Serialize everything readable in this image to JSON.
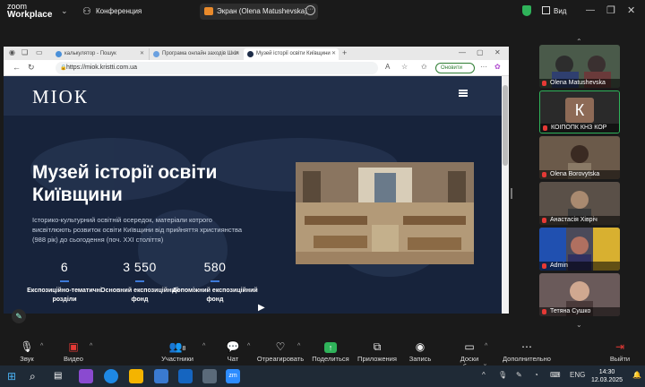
{
  "zoom": {
    "logo_line1": "zoom",
    "logo_line2": "Workplace",
    "chevron": "⌄",
    "meeting_title": "Конференция",
    "screen_share_label": "Экран (Olena Matushevska)",
    "view_label": "Вид",
    "window_min": "—",
    "window_max": "❐",
    "window_close": "✕",
    "icons": {
      "meeting": "people-icon",
      "security": "shield-icon",
      "view": "grid-icon"
    }
  },
  "browser": {
    "tabs": [
      {
        "label": "калькулятор - Пошук"
      },
      {
        "label": "Програма онлайн заходів Шкіл"
      },
      {
        "label": "Музей історії освіти Київщини"
      }
    ],
    "new_tab": "+",
    "url": "https://miok.kristti.com.ua",
    "update_button": "Оновити",
    "site": {
      "logo": "МІОК",
      "hero_title_line1": "Музей історії освіти",
      "hero_title_line2": "Київщини",
      "hero_description": "Історико-культурний освітній осередок, матеріали котрого висвітлюють розвиток освіти Київщини від прийняття християнства (988 рік) до сьогодення (поч. XXI століття)",
      "stats": [
        {
          "value": "6",
          "label": "Експозиційно-тематичні розділи"
        },
        {
          "value": "3 550",
          "label": "Основний експозиційний фонд"
        },
        {
          "value": "580",
          "label": "Допоміжний експозиційний фонд"
        }
      ]
    }
  },
  "participants": [
    {
      "name": "Olena Matushevska",
      "tile_color": "#5a6b5a"
    },
    {
      "name": "КОІПОПК КНЗ КОР",
      "initial": "К",
      "tile_color": "#2a2a2a"
    },
    {
      "name": "Olena Borovytska",
      "tile_color": "#6b5a4a"
    },
    {
      "name": "Анастасія Хівріч",
      "tile_color": "#5a5048"
    },
    {
      "name": "Admin",
      "tile_color": "#4a4a5a"
    },
    {
      "name": "Тетяна Сушко",
      "tile_color": "#6a5a5a"
    }
  ],
  "toolbar": {
    "audio": "Звук",
    "video": "Видео",
    "participants": "Участники",
    "participants_count": "8",
    "chat": "Чат",
    "react": "Отреагировать",
    "share": "Поделиться",
    "apps": "Приложения",
    "record": "Запись",
    "whiteboards": "Доски сообщений",
    "more": "Дополнительно",
    "leave": "Выйти"
  },
  "taskbar": {
    "time": "14:30",
    "date": "12.03.2025",
    "lang": "ENG"
  }
}
